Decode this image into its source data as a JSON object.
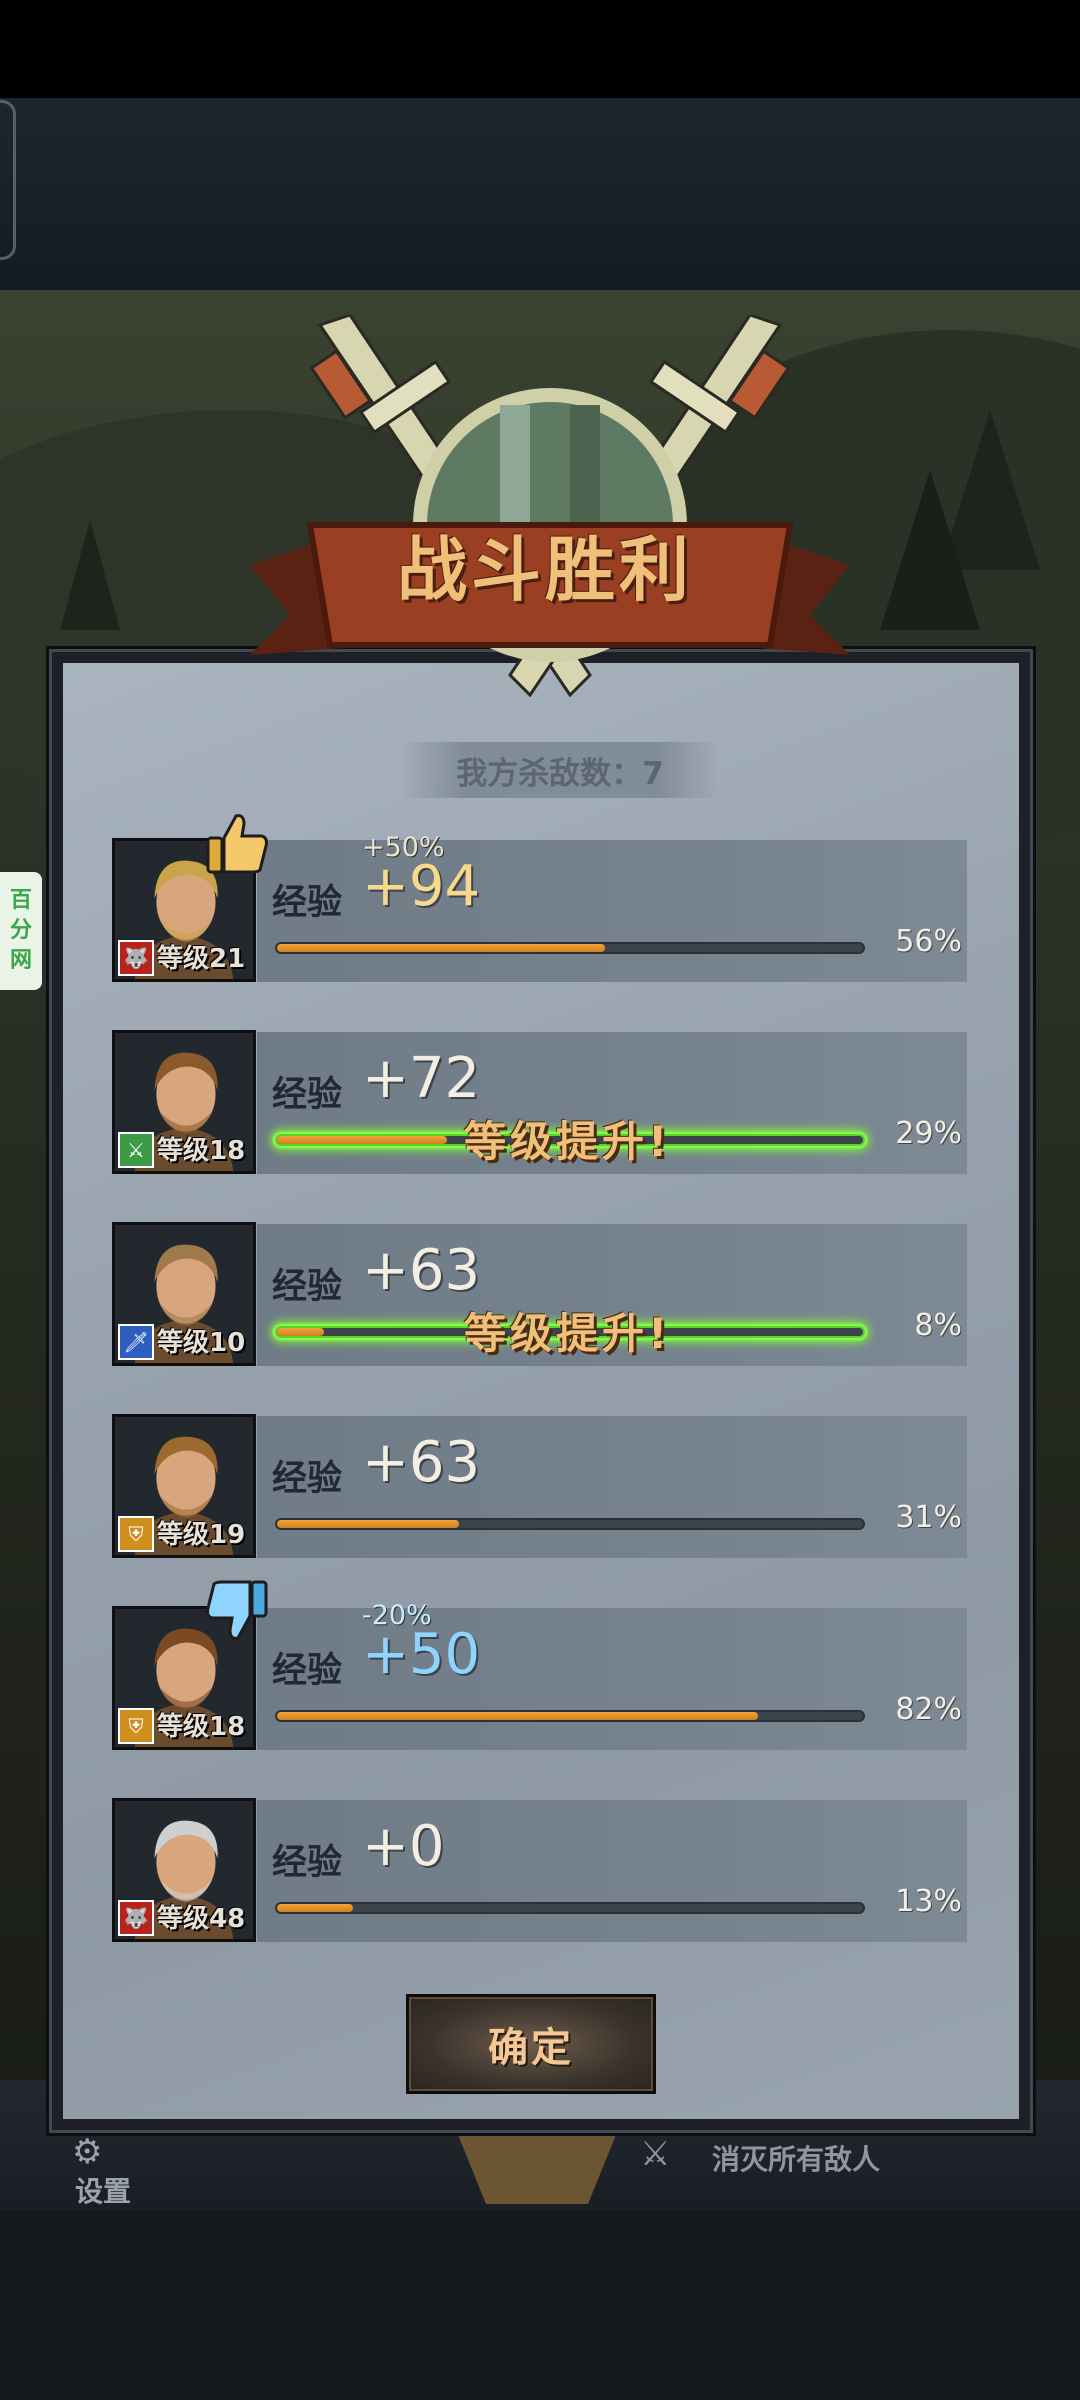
{
  "title": "战斗胜利",
  "kills": "我方杀敌数：7",
  "exp_label": "经验",
  "level_up_text": "等级提升!",
  "confirm_label": "确定",
  "watermark": [
    "百",
    "分",
    "网"
  ],
  "hud": {
    "settings": "设置",
    "kill_all": "消灭所有敌人"
  },
  "colors": {
    "exp_fill": "#e3921f",
    "level_up_glow": "#7dff37",
    "accent_gold": "#f0c07a",
    "penalty_blue": "#8fd3ff"
  },
  "heroes": [
    {
      "level": "等级21",
      "exp": "+94",
      "bonus": "+50%",
      "badge": "thumbs-up-icon",
      "progress_percent": "56%",
      "progress": 56,
      "level_up": false,
      "class_icon": "wolf-icon",
      "hair": "#c9a44a"
    },
    {
      "level": "等级18",
      "exp": "+72",
      "bonus": "",
      "badge": "",
      "progress_percent": "29%",
      "progress": 29,
      "level_up": true,
      "class_icon": "crossed-swords-icon",
      "hair": "#8b5a2b"
    },
    {
      "level": "等级10",
      "exp": "+63",
      "bonus": "",
      "badge": "",
      "progress_percent": "8%",
      "progress": 8,
      "level_up": true,
      "class_icon": "sword-icon",
      "hair": "#a07a4d"
    },
    {
      "level": "等级19",
      "exp": "+63",
      "bonus": "",
      "badge": "",
      "progress_percent": "31%",
      "progress": 31,
      "level_up": false,
      "class_icon": "shield-icon",
      "hair": "#9b6a2e"
    },
    {
      "level": "等级18",
      "exp": "+50",
      "bonus": "-20%",
      "badge": "thumbs-down-icon",
      "progress_percent": "82%",
      "progress": 82,
      "level_up": false,
      "class_icon": "shield-icon",
      "hair": "#7a4a24"
    },
    {
      "level": "等级48",
      "exp": "+0",
      "bonus": "",
      "badge": "",
      "progress_percent": "13%",
      "progress": 13,
      "level_up": false,
      "class_icon": "wolf-icon",
      "hair": "#cfcfcf"
    }
  ]
}
